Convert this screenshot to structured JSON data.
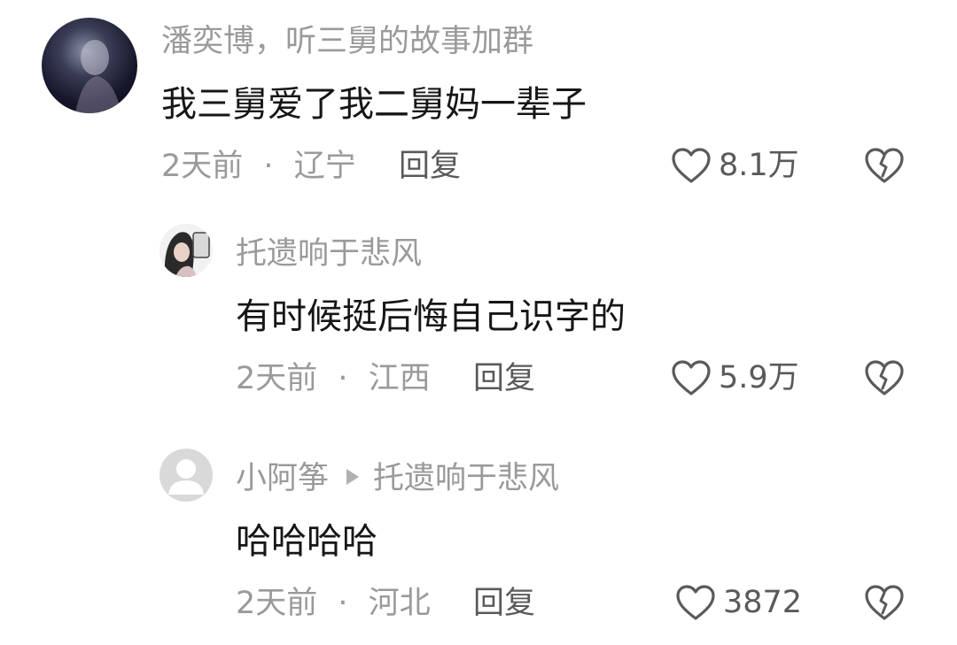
{
  "comments": [
    {
      "name": "潘奕博，听三舅的故事加群",
      "text": "我三舅爱了我二舅妈一辈子",
      "time": "2天前",
      "location": "辽宁",
      "reply_label": "回复",
      "likes": "8.1万"
    },
    {
      "name": "托遗响于悲风",
      "text": "有时候挺后悔自己识字的",
      "time": "2天前",
      "location": "江西",
      "reply_label": "回复",
      "likes": "5.9万"
    },
    {
      "name": "小阿筝",
      "reply_to": "托遗响于悲风",
      "text": "哈哈哈哈",
      "time": "2天前",
      "location": "河北",
      "reply_label": "回复",
      "likes": "3872"
    }
  ],
  "meta_separator": "·",
  "icons": {
    "like": "heart-outline-icon",
    "dislike": "broken-heart-icon",
    "reply_arrow": "triangle-right-icon"
  },
  "colors": {
    "secondary_text": "#9a9a9a",
    "primary_text": "#161616"
  }
}
